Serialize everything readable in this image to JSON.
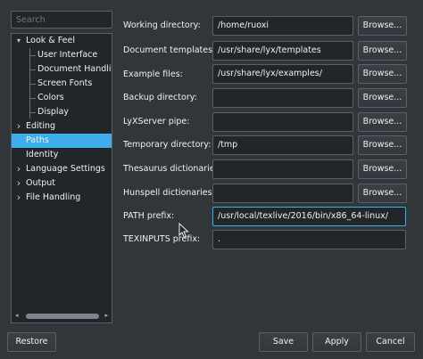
{
  "search": {
    "placeholder": "Search"
  },
  "tree": {
    "items": [
      {
        "label": "Look & Feel",
        "arrow": "▾"
      },
      {
        "label": "User Interface"
      },
      {
        "label": "Document Handling"
      },
      {
        "label": "Screen Fonts"
      },
      {
        "label": "Colors"
      },
      {
        "label": "Display"
      },
      {
        "label": "Editing",
        "arrow": "›"
      },
      {
        "label": "Paths"
      },
      {
        "label": "Identity"
      },
      {
        "label": "Language Settings",
        "arrow": "›"
      },
      {
        "label": "Output",
        "arrow": "›"
      },
      {
        "label": "File Handling",
        "arrow": "›"
      }
    ],
    "selected": "Paths"
  },
  "form": {
    "rows": [
      {
        "label": "Working directory:",
        "value": "/home/ruoxi",
        "button": "Browse..."
      },
      {
        "label": "Document templates:",
        "value": "/usr/share/lyx/templates",
        "button": "Browse..."
      },
      {
        "label": "Example files:",
        "value": "/usr/share/lyx/examples/",
        "button": "Browse..."
      },
      {
        "label": "Backup directory:",
        "value": "",
        "button": "Browse..."
      },
      {
        "label": "LyXServer pipe:",
        "value": "",
        "button": "Browse..."
      },
      {
        "label": "Temporary directory:",
        "value": "/tmp",
        "button": "Browse..."
      },
      {
        "label": "Thesaurus dictionaries:",
        "value": "",
        "button": "Browse..."
      },
      {
        "label": "Hunspell dictionaries:",
        "value": "",
        "button": "Browse..."
      },
      {
        "label": "PATH prefix:",
        "value": "/usr/local/texlive/2016/bin/x86_64-linux/"
      },
      {
        "label": "TEXINPUTS prefix:",
        "value": "."
      }
    ]
  },
  "footer": {
    "restore": "Restore",
    "save": "Save",
    "apply": "Apply",
    "cancel": "Cancel"
  },
  "colors": {
    "background": "#31363b",
    "field": "#232629",
    "accent": "#3daee9",
    "text": "#eff0f1"
  }
}
